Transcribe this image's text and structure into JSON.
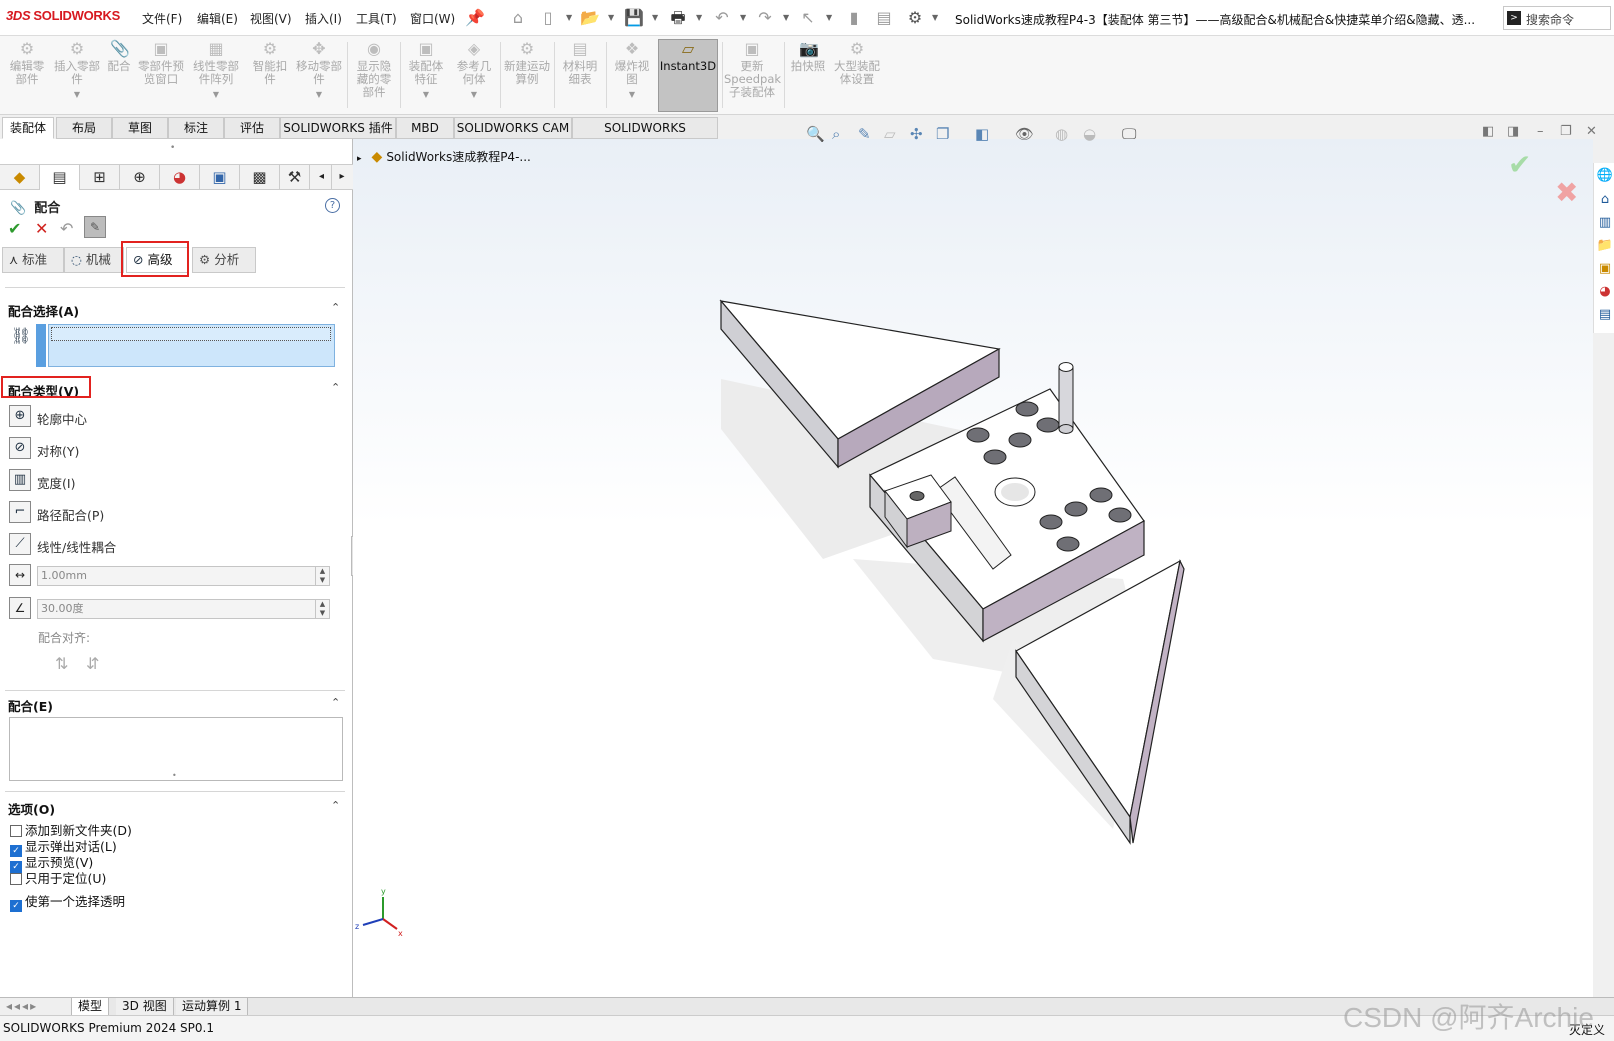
{
  "app": {
    "logo_mark": "3DS",
    "logo_text": "SOLIDWORKS",
    "doc_title": "SolidWorks速成教程P4-3【装配体 第三节】——高级配合&机械配合&快捷菜单介绍&隐藏、透...",
    "search_placeholder": "搜索命令"
  },
  "menu": [
    "文件(F)",
    "编辑(E)",
    "视图(V)",
    "插入(I)",
    "工具(T)",
    "窗口(W)"
  ],
  "commands": [
    {
      "label": "编辑零部件"
    },
    {
      "label": "插入零部件"
    },
    {
      "label": "配合"
    },
    {
      "label": "零部件预览窗口"
    },
    {
      "label": "线性零部件阵列"
    },
    {
      "label": "智能扣件"
    },
    {
      "label": "移动零部件"
    },
    {
      "label": "显示隐藏的零部件"
    },
    {
      "label": "装配体特征"
    },
    {
      "label": "参考几何体"
    },
    {
      "label": "新建运动算例"
    },
    {
      "label": "材料明细表"
    },
    {
      "label": "爆炸视图"
    },
    {
      "label": "Instant3D"
    },
    {
      "label": "更新Speedpak子装配体"
    },
    {
      "label": "拍快照"
    },
    {
      "label": "大型装配体设置"
    }
  ],
  "ribbon_tabs": [
    "装配体",
    "布局",
    "草图",
    "标注",
    "评估",
    "SOLIDWORKS 插件",
    "MBD",
    "SOLIDWORKS CAM",
    "SOLIDWORKS Inspection"
  ],
  "feature_tree": {
    "root": "SolidWorks速成教程P4-..."
  },
  "property_manager": {
    "title": "配合",
    "help": "?",
    "ok": "✔",
    "cancel": "✕",
    "subtabs": [
      "标准",
      "机械",
      "高级",
      "分析"
    ],
    "mate_selection": {
      "heading": "配合选择(A)"
    },
    "mate_types": {
      "heading": "配合类型(V)",
      "items": [
        "轮廓中心",
        "对称(Y)",
        "宽度(I)",
        "路径配合(P)",
        "线性/线性耦合"
      ]
    },
    "distance_value": "1.00mm",
    "angle_value": "30.00度",
    "mate_alignment": "配合对齐:",
    "mates": {
      "heading": "配合(E)"
    },
    "options": {
      "heading": "选项(O)",
      "items": [
        {
          "label": "添加到新文件夹(D)",
          "checked": false
        },
        {
          "label": "显示弹出对话(L)",
          "checked": true
        },
        {
          "label": "显示预览(V)",
          "checked": true
        },
        {
          "label": "只用于定位(U)",
          "checked": false
        },
        {
          "label": "使第一个选择透明",
          "checked": true
        }
      ]
    }
  },
  "triad": {
    "x": "x",
    "y": "y",
    "z": "z"
  },
  "bottom_tabs": [
    "模型",
    "3D 视图",
    "运动算例 1"
  ],
  "status": {
    "left": "SOLIDWORKS Premium 2024 SP0.1",
    "right": "灭定义"
  },
  "watermark": "CSDN @阿齐Archie",
  "colors": {
    "accent_red": "#d71920",
    "highlight_red": "#e2221f",
    "selection_blue": "#cde6fb"
  }
}
